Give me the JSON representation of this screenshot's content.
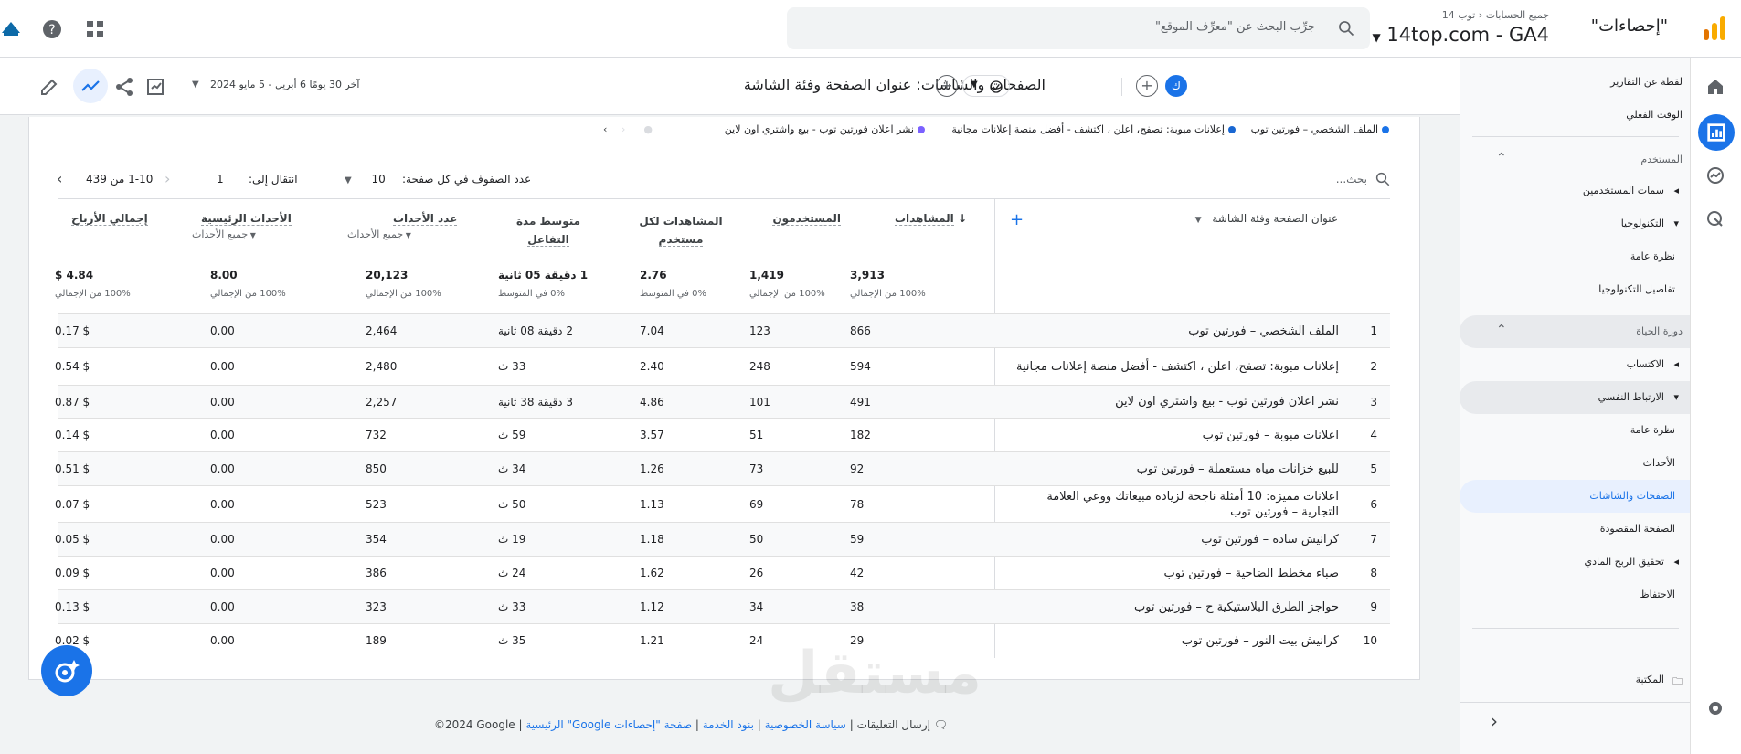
{
  "app": {
    "name": "\"إحصاءات\"",
    "breadcrumb": [
      "جميع الحسابات",
      "توب 14"
    ],
    "property": "14top.com - GA4",
    "search_placeholder": "جرِّب البحث عن \"معرِّف الموقع\""
  },
  "nav": {
    "items": [
      {
        "label": "لقطة عن التقارير",
        "type": "item"
      },
      {
        "label": "الوقت الفعلي",
        "type": "item"
      },
      {
        "label": "المستخدم",
        "type": "section"
      },
      {
        "label": "سمات المستخدمين",
        "type": "expandable"
      },
      {
        "label": "التكنولوجيا",
        "type": "expandable"
      },
      {
        "label": "نظرة عامة",
        "type": "item"
      },
      {
        "label": "تفاصيل التكنولوجيا",
        "type": "item"
      },
      {
        "label": "دورة الحياة",
        "type": "section"
      },
      {
        "label": "الاكتساب",
        "type": "expandable"
      },
      {
        "label": "الارتباط النفسي",
        "type": "expandable-open"
      },
      {
        "label": "نظرة عامة",
        "type": "item"
      },
      {
        "label": "الأحداث",
        "type": "item"
      },
      {
        "label": "الصفحات والشاشات",
        "type": "active"
      },
      {
        "label": "الصفحة المقصودة",
        "type": "item"
      },
      {
        "label": "تحقيق الربح المادي",
        "type": "expandable"
      },
      {
        "label": "الاحتفاظ",
        "type": "item"
      }
    ],
    "library": "المكتبة"
  },
  "header": {
    "avatar": "ك",
    "report_title": "الصفحات والشاشات: عنوان الصفحة وفئة الشاشة",
    "date_range": "آخر 30 يومًا  6 أبريل - 5 مايو 2024"
  },
  "legend": [
    {
      "label": "الملف الشخصي – فورتين توب",
      "color": "#1a73e8"
    },
    {
      "label": "إعلانات مبوبة: تصفح، اعلن ، اكتشف - أفضل منصة إعلانات مجانية",
      "color": "#1967d2"
    },
    {
      "label": "نشر اعلان فورتين توب - بيع واشتري اون لاين",
      "color": "#7b61ff"
    }
  ],
  "table_controls": {
    "search_placeholder": "بحث...",
    "rows_per_page_label": "عدد الصفوف في كل صفحة:",
    "rows_per_page_value": "10",
    "goto_label": "انتقال إلى:",
    "goto_value": "1",
    "pagination": "1-10 من 439"
  },
  "columns": {
    "dimension": "عنوان الصفحة وفئة الشاشة",
    "metrics": [
      {
        "label": "المشاهدات",
        "sort": "↓"
      },
      {
        "label": "المستخدمون"
      },
      {
        "label": "المشاهدات لكل مستخدم"
      },
      {
        "label": "متوسط مدة التفاعل"
      },
      {
        "label": "عدد الأحداث",
        "sub": "جميع الأحداث"
      },
      {
        "label": "الأحداث الرئيسية",
        "sub": "جميع الأحداث"
      },
      {
        "label": "إجمالي الأرباح"
      }
    ]
  },
  "totals": [
    {
      "value": "3,913",
      "sub": "100% من الإجمالي"
    },
    {
      "value": "1,419",
      "sub": "100% من الإجمالي"
    },
    {
      "value": "2.76",
      "sub": "0% في المتوسط"
    },
    {
      "value": "1 دقيقة 05 ثانية",
      "sub": "0% في المتوسط"
    },
    {
      "value": "20,123",
      "sub": "100% من الإجمالي"
    },
    {
      "value": "8.00",
      "sub": "100% من الإجمالي"
    },
    {
      "value": "$ 4.84",
      "sub": "100% من الإجمالي"
    }
  ],
  "rows": [
    {
      "n": "1",
      "title": "الملف الشخصي – فورتين توب",
      "v": [
        "866",
        "123",
        "7.04",
        "2 دقيقة 08 ثانية",
        "2,464",
        "0.00",
        "$ 0.17"
      ]
    },
    {
      "n": "2",
      "title": "إعلانات مبوبة: تصفح، اعلن ، اكتشف - أفضل منصة إعلانات مجانية",
      "v": [
        "594",
        "248",
        "2.40",
        "33 ث",
        "2,480",
        "0.00",
        "$ 0.54"
      ]
    },
    {
      "n": "3",
      "title": "نشر اعلان فورتين توب - بيع واشتري اون لاين",
      "v": [
        "491",
        "101",
        "4.86",
        "3 دقيقة 38 ثانية",
        "2,257",
        "0.00",
        "$ 0.87"
      ]
    },
    {
      "n": "4",
      "title": "اعلانات مبوبة – فورتين توب",
      "v": [
        "182",
        "51",
        "3.57",
        "59 ث",
        "732",
        "0.00",
        "$ 0.14"
      ]
    },
    {
      "n": "5",
      "title": "للبيع خزانات مياه مستعملة – فورتين توب",
      "v": [
        "92",
        "73",
        "1.26",
        "34 ث",
        "850",
        "0.00",
        "$ 0.51"
      ]
    },
    {
      "n": "6",
      "title": "اعلانات مميزة: 10 أمثلة ناجحة لزيادة مبيعاتك ووعي العلامة التجارية – فورتين توب",
      "v": [
        "78",
        "69",
        "1.13",
        "50 ث",
        "523",
        "0.00",
        "$ 0.07"
      ]
    },
    {
      "n": "7",
      "title": "كرانيش ساده – فورتين توب",
      "v": [
        "59",
        "50",
        "1.18",
        "19 ث",
        "354",
        "0.00",
        "$ 0.05"
      ]
    },
    {
      "n": "8",
      "title": "ضباء مخطط الضاحية – فورتين توب",
      "v": [
        "42",
        "26",
        "1.62",
        "24 ث",
        "386",
        "0.00",
        "$ 0.09"
      ]
    },
    {
      "n": "9",
      "title": "حواجز الطرق البلاستيكية ح – فورتين توب",
      "v": [
        "38",
        "34",
        "1.12",
        "33 ث",
        "323",
        "0.00",
        "$ 0.13"
      ]
    },
    {
      "n": "10",
      "title": "كرانيش بيت النور – فورتين توب",
      "v": [
        "29",
        "24",
        "1.21",
        "35 ث",
        "189",
        "0.00",
        "$ 0.02"
      ]
    }
  ],
  "footer": {
    "copyright": "©2024 Google",
    "links": [
      "صفحة \"إحصاءات Google\" الرئيسية",
      "بنود الخدمة",
      "سياسة الخصوصية"
    ],
    "feedback": "إرسال التعليقات"
  },
  "watermark": "مستقل"
}
